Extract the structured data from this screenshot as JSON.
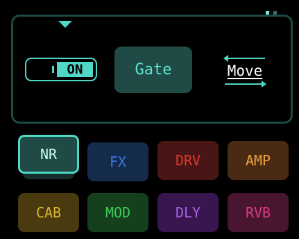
{
  "toggle": {
    "label": "ON"
  },
  "effect": {
    "name": "Gate"
  },
  "move": {
    "label": "Move"
  },
  "tiles": [
    {
      "label": "NR",
      "bg": "#1f4a46",
      "fg": "#c6fff8",
      "active": true
    },
    {
      "label": "FX",
      "bg": "#142b4c",
      "fg": "#3b78e0",
      "active": false
    },
    {
      "label": "DRV",
      "bg": "#4a1515",
      "fg": "#e0382f",
      "active": false
    },
    {
      "label": "AMP",
      "bg": "#4a2a12",
      "fg": "#f0a33c",
      "active": false
    },
    {
      "label": "CAB",
      "bg": "#4a3a10",
      "fg": "#d8b530",
      "active": false
    },
    {
      "label": "MOD",
      "bg": "#14401d",
      "fg": "#3dcc5a",
      "active": false
    },
    {
      "label": "DLY",
      "bg": "#3a1650",
      "fg": "#a462e0",
      "active": false
    },
    {
      "label": "RVB",
      "bg": "#4a1530",
      "fg": "#e03a82",
      "active": false
    }
  ]
}
